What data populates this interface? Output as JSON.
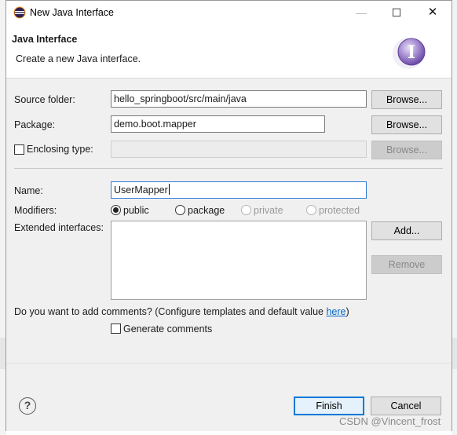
{
  "window": {
    "title": "New Java Interface",
    "minimize_glyph": "—",
    "maximize_glyph": "☐",
    "close_glyph": "✕"
  },
  "header": {
    "title": "Java Interface",
    "description": "Create a new Java interface."
  },
  "form": {
    "source_folder": {
      "label": "Source folder:",
      "value": "hello_springboot/src/main/java",
      "button": "Browse..."
    },
    "package": {
      "label": "Package:",
      "value": "demo.boot.mapper",
      "button": "Browse..."
    },
    "enclosing_type": {
      "label": "Enclosing type:",
      "value": "",
      "button": "Browse...",
      "checked": false
    },
    "name": {
      "label": "Name:",
      "value": "UserMapper"
    },
    "modifiers": {
      "label": "Modifiers:",
      "options": [
        {
          "label": "public",
          "selected": true,
          "enabled": true
        },
        {
          "label": "package",
          "selected": false,
          "enabled": true
        },
        {
          "label": "private",
          "selected": false,
          "enabled": false
        },
        {
          "label": "protected",
          "selected": false,
          "enabled": false
        }
      ]
    },
    "extended_interfaces": {
      "label": "Extended interfaces:",
      "add_button": "Add...",
      "remove_button": "Remove"
    },
    "comments": {
      "question_prefix": "Do you want to add comments? (Configure templates and default value ",
      "link": "here",
      "question_suffix": ")",
      "checkbox_label": "Generate comments",
      "checked": false
    }
  },
  "footer": {
    "help_glyph": "?",
    "finish": "Finish",
    "cancel": "Cancel"
  },
  "watermark": "CSDN @Vincent_frost",
  "colors": {
    "accent": "#0078d7",
    "link": "#0066cc",
    "dialog_bg": "#f0f0f0"
  }
}
